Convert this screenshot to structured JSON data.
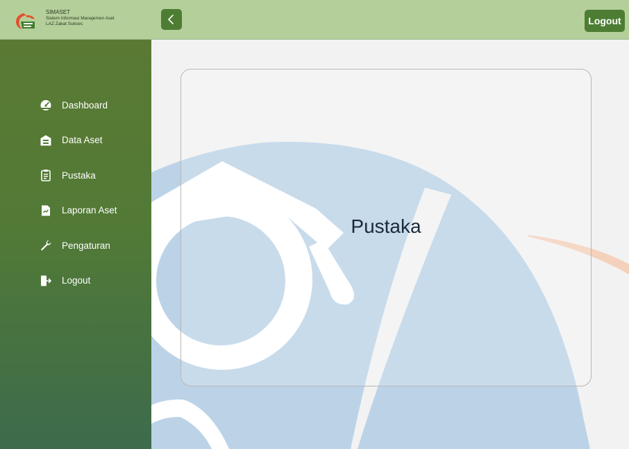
{
  "brand": {
    "name": "SIMASET",
    "subtitle": "Sistem Informasi Manajemen Aset",
    "org": "LAZ Zakat Sukses",
    "logo_icon": "zakat-sukses-logo-icon"
  },
  "topbar": {
    "back_icon": "chevron-left-icon",
    "logout_label": "Logout"
  },
  "sidebar": {
    "items": [
      {
        "label": "Dashboard",
        "icon": "speedometer-icon"
      },
      {
        "label": "Data Aset",
        "icon": "building-icon"
      },
      {
        "label": "Pustaka",
        "icon": "clipboard-icon"
      },
      {
        "label": "Laporan Aset",
        "icon": "report-file-icon"
      },
      {
        "label": "Pengaturan",
        "icon": "wrench-icon"
      },
      {
        "label": "Logout",
        "icon": "sign-out-icon"
      }
    ]
  },
  "main": {
    "title": "Pustaka"
  },
  "colors": {
    "header_bg": "#b5cf9b",
    "button_bg": "#4d7d33",
    "sidebar_top": "#5a7a33",
    "sidebar_bottom": "#3d6b4c",
    "watermark_blue": "#bcd3e7",
    "watermark_orange": "#f2c8ad"
  }
}
